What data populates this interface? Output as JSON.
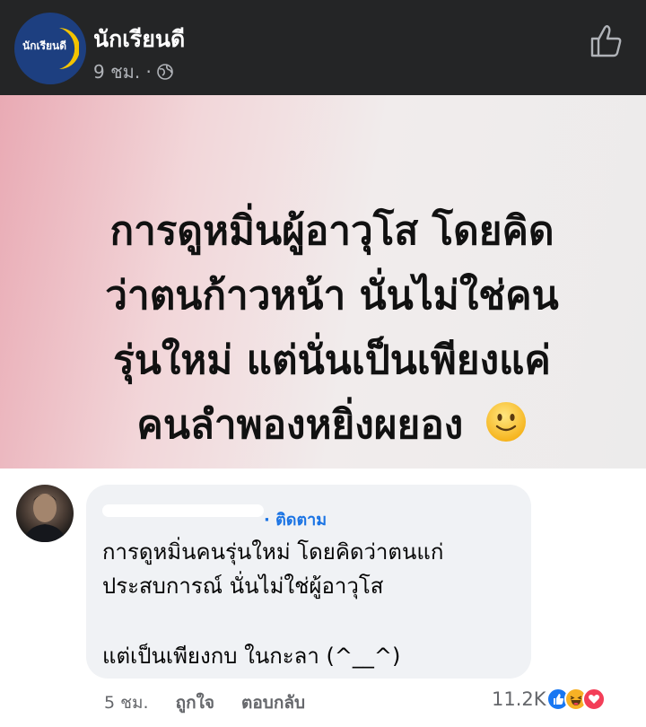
{
  "header": {
    "page_name": "นักเรียนดี",
    "logo_text": "นักเรียนดี",
    "post_time": "9 ชม. ·",
    "colors": {
      "background": "#242526",
      "avatar": "#1d3f80",
      "logo_accent": "#f3c300"
    }
  },
  "post": {
    "quote_lines": [
      "การดูหมิ่นผู้อาวุโส โดยคิด",
      "ว่าตนก้าวหน้า นั่นไม่ใช่คน",
      "รุ่นใหม่ แต่นั่นเป็นเพียงแค่",
      "คนลำพองหยิ่งผยอง"
    ],
    "emoji": "slightly-smiling-face-icon"
  },
  "comment": {
    "follow_label": "· ติดตาม",
    "lines": [
      "การดูหมิ่นคนรุ่นใหม่ โดยคิดว่าตนแก่",
      "ประสบการณ์ นั่นไม่ใช่ผู้อาวุโส",
      "แต่เป็นเพียงกบ ในกะลา (^__^)"
    ],
    "time": "5 ชม.",
    "like_label": "ถูกใจ",
    "reply_label": "ตอบกลับ",
    "reaction_count": "11.2K",
    "reactions": [
      "like-icon",
      "haha-icon",
      "love-icon"
    ]
  }
}
